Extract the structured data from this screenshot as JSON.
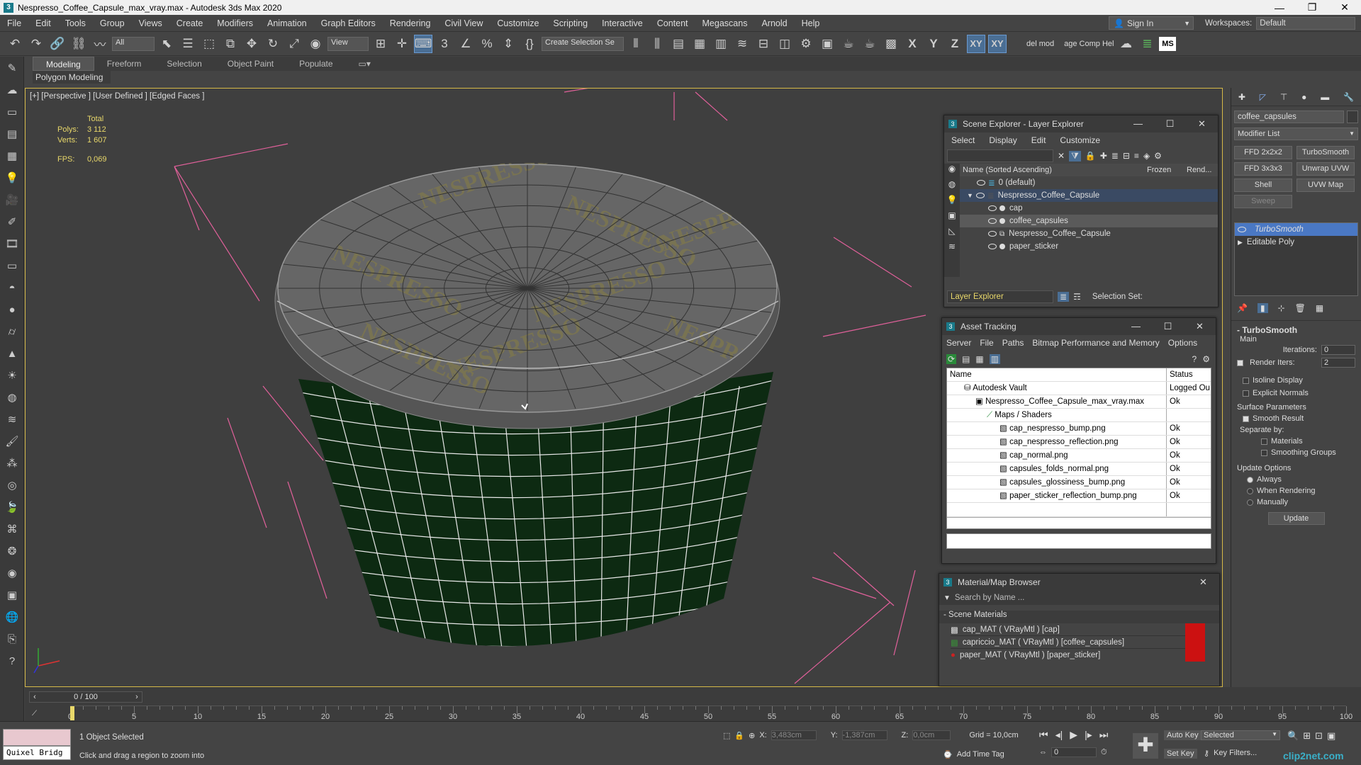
{
  "title": "Nespresso_Coffee_Capsule_max_vray.max - Autodesk 3ds Max 2020",
  "window_controls": [
    "—",
    "❐",
    "✕"
  ],
  "menu": [
    "File",
    "Edit",
    "Tools",
    "Group",
    "Views",
    "Create",
    "Modifiers",
    "Animation",
    "Graph Editors",
    "Rendering",
    "Civil View",
    "Customize",
    "Scripting",
    "Interactive",
    "Content",
    "Megascans",
    "Arnold",
    "Help"
  ],
  "signin": "Sign In",
  "workspaces_label": "Workspaces:",
  "workspaces_value": "Default",
  "toolbar": {
    "filter": "All",
    "view": "View",
    "selection_set": "Create Selection Se",
    "del_mod": "del mod",
    "comp_help": "age Comp Hel",
    "ms": "MS",
    "x": "X",
    "y": "Y",
    "z": "Z",
    "xy": "XY",
    "xy2": "XY"
  },
  "ribbon_tabs": [
    "Modeling",
    "Freeform",
    "Selection",
    "Object Paint",
    "Populate"
  ],
  "ribbon_sub": "Polygon Modeling",
  "viewport": {
    "label": "[+] [Perspective ] [User Defined ] [Edged Faces ]",
    "total": "Total",
    "polys_label": "Polys:",
    "polys": "3 112",
    "verts_label": "Verts:",
    "verts": "1 607",
    "fps_label": "FPS:",
    "fps": "0,069",
    "brand": "NESPRESSO"
  },
  "scene_explorer": {
    "title": "Scene Explorer - Layer Explorer",
    "menu": [
      "Select",
      "Display",
      "Edit",
      "Customize"
    ],
    "col_name": "Name (Sorted Ascending)",
    "col_frozen": "Frozen",
    "col_rend": "Rend...",
    "rows": [
      {
        "label": "0 (default)",
        "indent": 1
      },
      {
        "label": "Nespresso_Coffee_Capsule",
        "indent": 1
      },
      {
        "label": "cap",
        "indent": 2
      },
      {
        "label": "coffee_capsules",
        "indent": 2
      },
      {
        "label": "Nespresso_Coffee_Capsule",
        "indent": 2
      },
      {
        "label": "paper_sticker",
        "indent": 2
      }
    ],
    "layer_dropdown": "Layer Explorer",
    "selection_set": "Selection Set:"
  },
  "asset_tracking": {
    "title": "Asset Tracking",
    "menu": [
      "Server",
      "File",
      "Paths",
      "Bitmap Performance and Memory",
      "Options"
    ],
    "col_name": "Name",
    "col_status": "Status",
    "rows": [
      {
        "name": "Autodesk Vault",
        "status": "Logged Ou"
      },
      {
        "name": "Nespresso_Coffee_Capsule_max_vray.max",
        "status": "Ok"
      },
      {
        "name": "Maps / Shaders",
        "status": ""
      },
      {
        "name": "cap_nespresso_bump.png",
        "status": "Ok"
      },
      {
        "name": "cap_nespresso_reflection.png",
        "status": "Ok"
      },
      {
        "name": "cap_normal.png",
        "status": "Ok"
      },
      {
        "name": "capsules_folds_normal.png",
        "status": "Ok"
      },
      {
        "name": "capsules_glossiness_bump.png",
        "status": "Ok"
      },
      {
        "name": "paper_sticker_reflection_bump.png",
        "status": "Ok"
      }
    ]
  },
  "material_browser": {
    "title": "Material/Map Browser",
    "search": "Search by Name ...",
    "section": "Scene Materials",
    "items": [
      "cap_MAT ( VRayMtl ) [cap]",
      "capriccio_MAT ( VRayMtl ) [coffee_capsules]",
      "paper_MAT ( VRayMtl ) [paper_sticker]"
    ]
  },
  "command_panel": {
    "object_name": "coffee_capsules",
    "modifier_list": "Modifier List",
    "buttons": [
      "FFD 2x2x2",
      "TurboSmooth",
      "FFD 3x3x3",
      "Unwrap UVW",
      "Shell",
      "UVW Map",
      "Sweep"
    ],
    "stack": [
      "TurboSmooth",
      "Editable Poly"
    ],
    "rollout": "TurboSmooth",
    "main": "Main",
    "iterations_label": "Iterations:",
    "iterations": "0",
    "render_iters_label": "Render Iters:",
    "render_iters": "2",
    "isoline": "Isoline Display",
    "explicit_normals": "Explicit Normals",
    "surface_params": "Surface Parameters",
    "smooth_result": "Smooth Result",
    "separate_by": "Separate by:",
    "materials": "Materials",
    "smoothing_groups": "Smoothing Groups",
    "update_options": "Update Options",
    "always": "Always",
    "when_rendering": "When Rendering",
    "manually": "Manually",
    "update": "Update"
  },
  "timeline": {
    "frame": "0 / 100",
    "ticks": [
      "0",
      "5",
      "10",
      "15",
      "20",
      "25",
      "30",
      "35",
      "40",
      "45",
      "50",
      "55",
      "60",
      "65",
      "70",
      "75",
      "80",
      "85",
      "90",
      "95",
      "100"
    ]
  },
  "status": {
    "quixel": "Quixel Bridg",
    "selected": "1 Object Selected",
    "hint": "Click and drag a region to zoom into",
    "x_label": "X:",
    "x": "3,483cm",
    "y_label": "Y:",
    "y": "-1,387cm",
    "z_label": "Z:",
    "z": "0,0cm",
    "grid": "Grid = 10,0cm",
    "add_time_tag": "Add Time Tag",
    "auto_key": "Auto Key",
    "set_key": "Set Key",
    "key_mode": "Selected",
    "key_filters": "Key Filters...",
    "frame_spin": "0",
    "watermark": "clip2net.com"
  }
}
